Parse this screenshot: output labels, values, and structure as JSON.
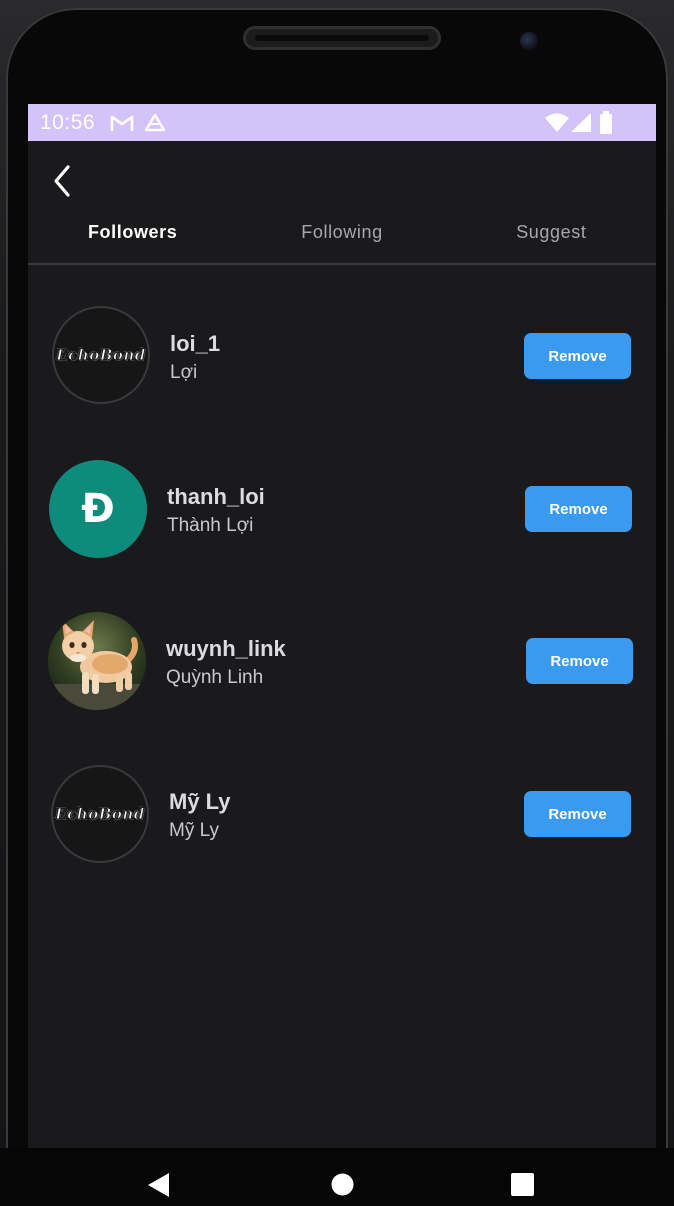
{
  "status_bar": {
    "time": "10:56",
    "left_icons": [
      "gmail-icon",
      "drive-icon"
    ],
    "right_icons": [
      "wifi-icon",
      "signal-icon",
      "battery-icon"
    ],
    "background": "#d4c3fb"
  },
  "app_bar": {
    "back_icon": "chevron-left-icon"
  },
  "tabs": [
    {
      "label": "Followers",
      "active": true
    },
    {
      "label": "Following",
      "active": false
    },
    {
      "label": "Suggest",
      "active": false
    }
  ],
  "followers": [
    {
      "username": "loi_1",
      "full_name": "Lợi",
      "avatar_type": "brand-logo",
      "avatar_text": "EchoBond",
      "button_label": "Remove"
    },
    {
      "username": "thanh_loi",
      "full_name": "Thành Lợi",
      "avatar_type": "letter",
      "avatar_text": "Đ",
      "avatar_color": "#0f8b7c",
      "button_label": "Remove"
    },
    {
      "username": "wuynh_link",
      "full_name": "Quỳnh Linh",
      "avatar_type": "photo-kitten",
      "button_label": "Remove"
    },
    {
      "username": "Mỹ Ly",
      "full_name": "Mỹ Ly",
      "avatar_type": "brand-logo",
      "avatar_text": "EchoBond",
      "button_label": "Remove"
    }
  ],
  "colors": {
    "screen_background": "#1a191b",
    "accent_button": "#3a9af0",
    "active_tab_text": "#ffffff",
    "inactive_tab_text": "#a8a8ac"
  },
  "nav_bar": {
    "icons": [
      "back-triangle-icon",
      "home-circle-icon",
      "recents-square-icon"
    ]
  }
}
